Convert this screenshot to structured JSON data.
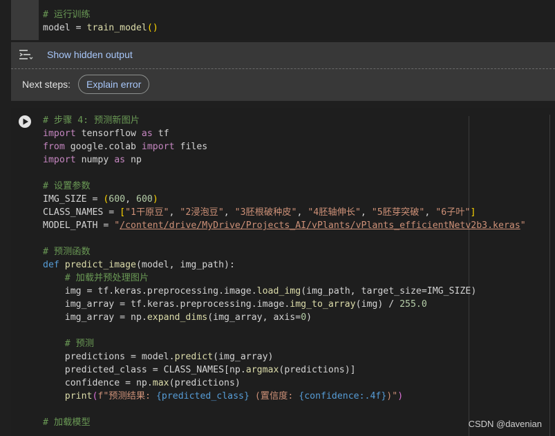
{
  "top_cell": {
    "comment": "# 运行训练",
    "line2_var": "model",
    "line2_eq": " = ",
    "line2_fn": "train_model",
    "line2_paren": "()"
  },
  "output": {
    "show_hidden_label": "Show hidden output",
    "next_steps_label": "Next steps:",
    "explain_error_label": "Explain error"
  },
  "main_cell": {
    "l1": "# 步骤 4: 预测新图片",
    "l2_kw": "import",
    "l2_rest": " tensorflow ",
    "l2_as": "as",
    "l2_alias": " tf",
    "l3_kw": "from",
    "l3_mod": " google.colab ",
    "l3_imp": "import",
    "l3_name": " files",
    "l4_kw": "import",
    "l4_rest": " numpy ",
    "l4_as": "as",
    "l4_alias": " np",
    "l6": "# 设置参数",
    "l7_var": "IMG_SIZE = ",
    "l7_open": "(",
    "l7_a": "600",
    "l7_sep": ", ",
    "l7_b": "600",
    "l7_close": ")",
    "l8_var": "CLASS_NAMES = ",
    "l8_open": "[",
    "l8_items": [
      "\"1干原豆\"",
      "\"2浸泡豆\"",
      "\"3胚根破种皮\"",
      "\"4胚轴伸长\"",
      "\"5胚芽突破\"",
      "\"6子叶\""
    ],
    "l8_sep": ", ",
    "l8_close": "]",
    "l9_var": "MODEL_PATH = ",
    "l9_q1": "\"",
    "l9_path": "/content/drive/MyDrive/Projects_AI/vPlants/vPlants_efficientNetv2b3.keras",
    "l9_q2": "\"",
    "l11": "# 预测函数",
    "l12_def": "def",
    "l12_fn": " predict_image",
    "l12_args": "(model, img_path)",
    "l12_colon": ":",
    "l13": "    # 加载并预处理图片",
    "l14_a": "    img = tf.keras.preprocessing.image.",
    "l14_fn": "load_img",
    "l14_b": "(img_path, target_size=IMG_SIZE)",
    "l15_a": "    img_array = tf.keras.preprocessing.image.",
    "l15_fn": "img_to_array",
    "l15_b": "(img) / ",
    "l15_num": "255.0",
    "l16_a": "    img_array = np.",
    "l16_fn": "expand_dims",
    "l16_b": "(img_array, axis=",
    "l16_num": "0",
    "l16_c": ")",
    "l18": "    # 预测",
    "l19_a": "    predictions = model.",
    "l19_fn": "predict",
    "l19_b": "(img_array)",
    "l20_a": "    predicted_class = CLASS_NAMES",
    "l20_b": "[np.",
    "l20_fn": "argmax",
    "l20_c": "(predictions)]",
    "l21_a": "    confidence = np.",
    "l21_fn": "max",
    "l21_b": "(predictions)",
    "l22_print": "    print",
    "l22_open": "(",
    "l22_f": "f\"预测结果: ",
    "l22_i1": "{predicted_class}",
    "l22_mid": " (置信度: ",
    "l22_i2": "{confidence:.4f}",
    "l22_end": ")\"",
    "l22_close": ")",
    "l24": "# 加载模型"
  },
  "watermark": "CSDN @davenian"
}
